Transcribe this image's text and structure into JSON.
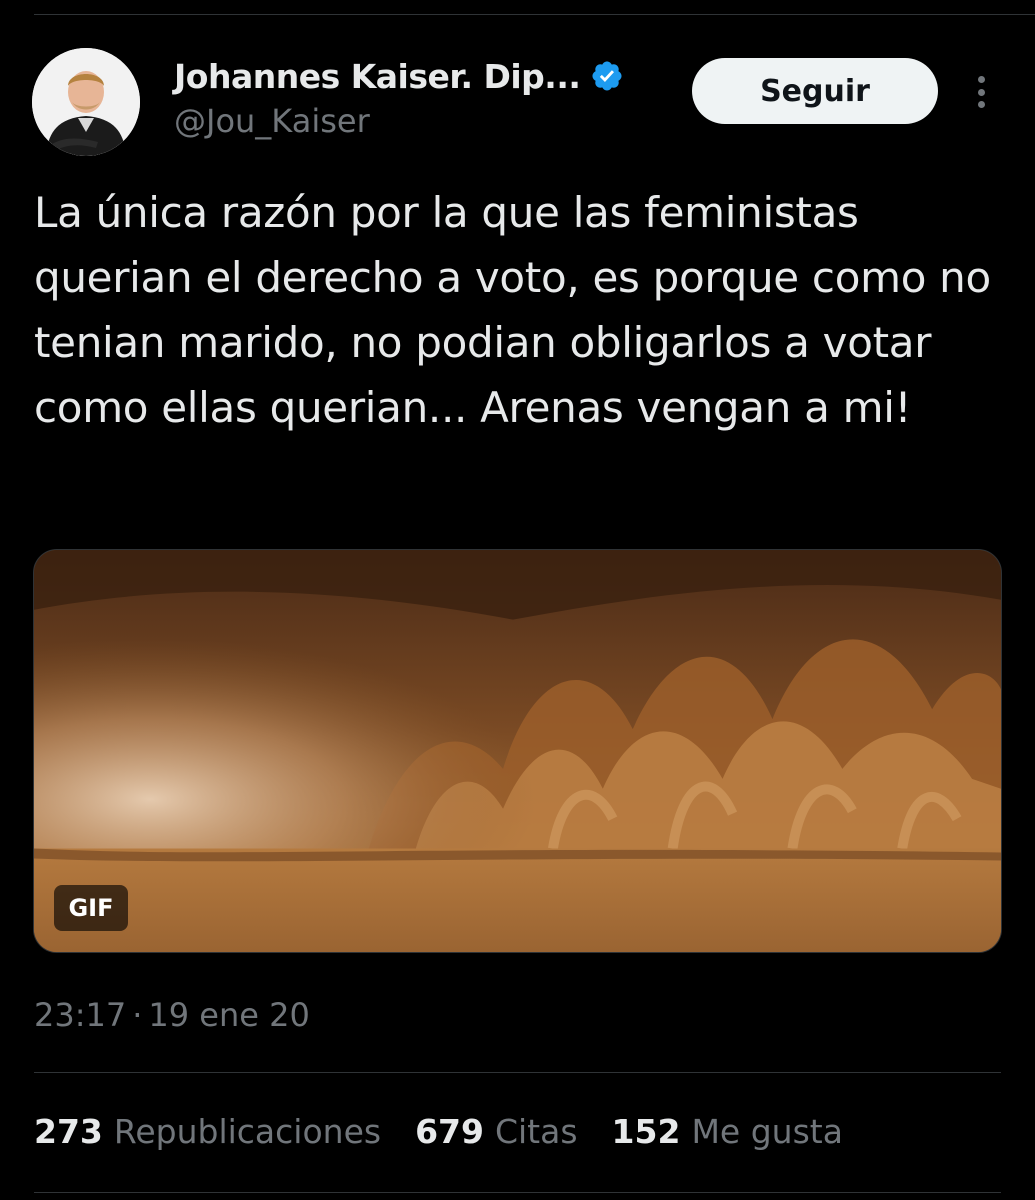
{
  "author": {
    "display_name": "Johannes Kaiser. Dip...",
    "handle": "@Jou_Kaiser",
    "verified": true,
    "verified_color": "#1d9bf0"
  },
  "header": {
    "follow_label": "Seguir"
  },
  "tweet": {
    "text": "La única razón por la que las feministas querian el derecho a voto, es porque como no tenian marido, no podian obligarlos a votar como ellas querian... Arenas vengan a mi!",
    "media_badge": "GIF",
    "time": "23:17",
    "separator": "·",
    "date": "19 ene 20"
  },
  "stats": [
    {
      "count": "273",
      "label": "Republicaciones"
    },
    {
      "count": "679",
      "label": "Citas"
    },
    {
      "count": "152",
      "label": "Me gusta"
    }
  ],
  "colors": {
    "background": "#000000",
    "text_primary": "#e7e9ea",
    "text_secondary": "#71767b",
    "divider": "#2f3336",
    "follow_bg": "#eff3f4"
  }
}
